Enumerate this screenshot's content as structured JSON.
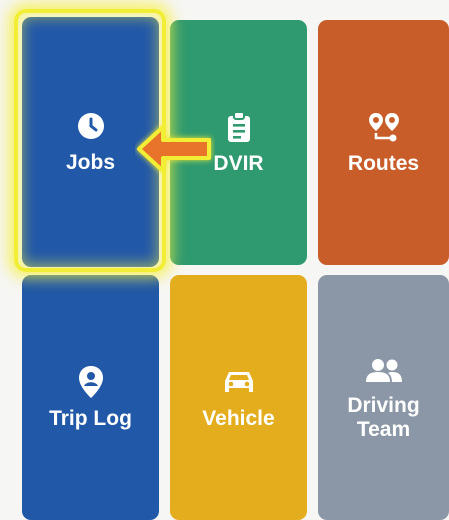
{
  "tiles": [
    {
      "label": "Jobs",
      "icon": "clock-icon",
      "color": "#2258a8"
    },
    {
      "label": "DVIR",
      "icon": "clipboard-icon",
      "color": "#2f9a6f"
    },
    {
      "label": "Routes",
      "icon": "route-icon",
      "color": "#c85d2a"
    },
    {
      "label": "Trip Log",
      "icon": "location-pin-icon",
      "color": "#2158a7"
    },
    {
      "label": "Vehicle",
      "icon": "car-icon",
      "color": "#e3ad1e"
    },
    {
      "label": "Driving Team",
      "label_line1": "Driving",
      "label_line2": "Team",
      "icon": "people-icon",
      "color": "#8b97a6"
    }
  ],
  "annotation": {
    "highlight_color": "#f2ee36",
    "arrow_color": "#e8732a",
    "highlighted_tile": "Jobs"
  }
}
